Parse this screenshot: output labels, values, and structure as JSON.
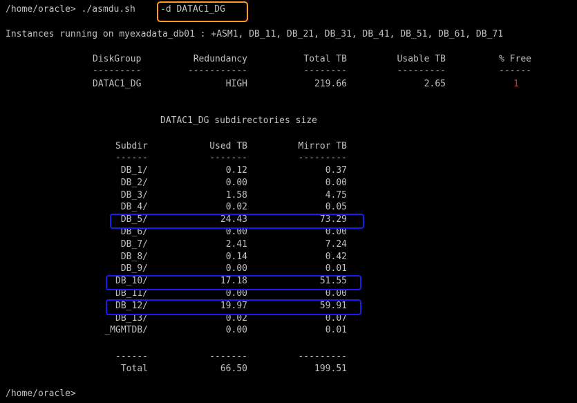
{
  "prompt1": "/home/oracle> ./asmdu.sh",
  "command_arg": "-d DATAC1_DG",
  "instances_line": "Instances running on myexadata_db01 : +ASM1, DB_11, DB_21, DB_31, DB_41, DB_51, DB_61, DB_71",
  "dg_table": {
    "headers": [
      "DiskGroup",
      "Redundancy",
      "Total TB",
      "Usable TB",
      "% Free"
    ],
    "dashes": [
      "---------",
      "-----------",
      "--------",
      "---------",
      "------"
    ],
    "row": [
      "DATAC1_DG",
      "HIGH",
      "219.66",
      "2.65",
      "1"
    ]
  },
  "sub_title": "DATAC1_DG subdirectories size",
  "sub_table": {
    "headers": [
      "Subdir",
      "Used TB",
      "Mirror TB"
    ],
    "dashes": [
      "------",
      "-------",
      "---------"
    ],
    "rows": [
      [
        "DB_1/",
        "0.12",
        "0.37"
      ],
      [
        "DB_2/",
        "0.00",
        "0.00"
      ],
      [
        "DB_3/",
        "1.58",
        "4.75"
      ],
      [
        "DB_4/",
        "0.02",
        "0.05"
      ],
      [
        "DB_5/",
        "24.43",
        "73.29"
      ],
      [
        "DB_6/",
        "0.00",
        "0.00"
      ],
      [
        "DB_7/",
        "2.41",
        "7.24"
      ],
      [
        "DB_8/",
        "0.14",
        "0.42"
      ],
      [
        "DB_9/",
        "0.00",
        "0.01"
      ],
      [
        "DB_10/",
        "17.18",
        "51.55"
      ],
      [
        "DB_11/",
        "0.00",
        "0.00"
      ],
      [
        "DB_12/",
        "19.97",
        "59.91"
      ],
      [
        "DB_13/",
        "0.02",
        "0.07"
      ],
      [
        "_MGMTDB/",
        "0.00",
        "0.01"
      ]
    ],
    "total_dashes": [
      "------",
      "-------",
      "---------"
    ],
    "total": [
      "Total",
      "66.50",
      "199.51"
    ]
  },
  "prompt2": "/home/oracle>",
  "colors": {
    "background": "#000000",
    "text": "#c0c0c0",
    "free_value": "#e03030",
    "command_highlight": "#ff9a1f",
    "row_highlight": "#1c1cf0"
  },
  "highlighted_rows": [
    "DB_5/",
    "DB_10/",
    "DB_12/"
  ]
}
